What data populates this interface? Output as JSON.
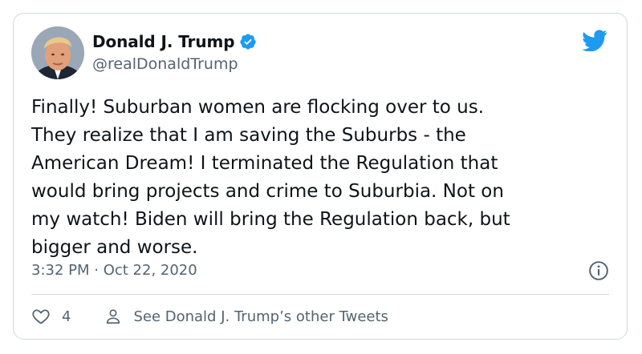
{
  "tweet": {
    "author_name": "Donald J. Trump",
    "handle": "@realDonaldTrump",
    "text": "Finally! Suburban women are flocking over to us.\nThey realize that I am saving the Suburbs - the\nAmerican Dream! I terminated the Regulation that\nwould bring projects and crime to Suburbia. Not on\nmy watch! Biden will bring the Regulation back, but\nbigger and worse.",
    "timestamp": "3:32 PM · Oct 22, 2020",
    "like_count": "4",
    "other_tweets_label": "See Donald J. Trump’s other Tweets"
  },
  "icons": {
    "verified": "verified-badge-icon",
    "brand": "twitter-bird-icon",
    "info": "info-icon",
    "like": "heart-icon",
    "profile": "person-icon"
  },
  "colors": {
    "brand": "#1d9bf0",
    "text": "#0f1419",
    "secondary": "#536471",
    "border": "#cfd9de"
  }
}
